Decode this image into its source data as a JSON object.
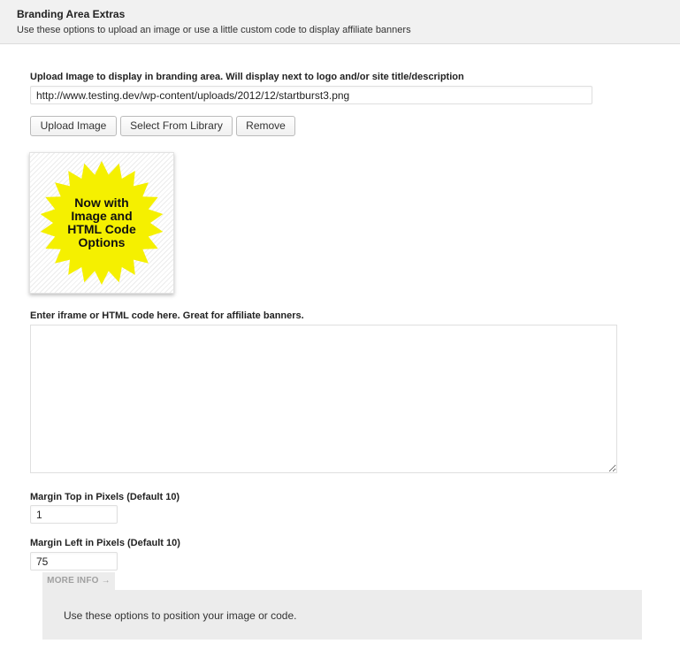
{
  "header": {
    "title": "Branding Area Extras",
    "description": "Use these options to upload an image or use a little custom code to display affiliate banners"
  },
  "upload": {
    "label": "Upload Image to display in branding area. Will display next to logo and/or site title/description",
    "value": "http://www.testing.dev/wp-content/uploads/2012/12/startburst3.png",
    "buttons": {
      "upload": "Upload Image",
      "library": "Select From Library",
      "remove": "Remove"
    }
  },
  "preview": {
    "lines": [
      "Now with",
      "Image and",
      "HTML Code",
      "Options"
    ],
    "burst_color": "#f5f000"
  },
  "code": {
    "label": "Enter iframe or HTML code here. Great for affiliate banners.",
    "value": ""
  },
  "margin_top": {
    "label": "Margin Top in Pixels (Default 10)",
    "value": "1"
  },
  "margin_left": {
    "label": "Margin Left in Pixels (Default 10)",
    "value": "75"
  },
  "more_info": {
    "tab_label": "MORE INFO →",
    "text": "Use these options to position your image or code."
  }
}
